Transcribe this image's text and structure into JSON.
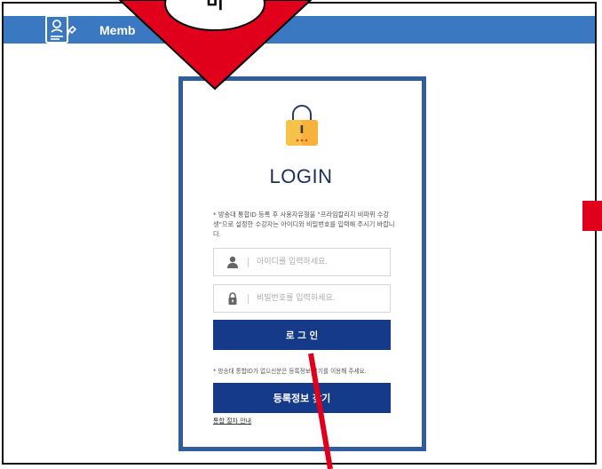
{
  "header": {
    "title": "Memb"
  },
  "annotation": {
    "step_label": "비"
  },
  "login": {
    "title": "LOGIN",
    "notice": "* 방송대 통합ID 등록 후 사용자유형을 \"프라임칼리지 비파위 수강생\"으로 설정한 수강자는 아이디와 비밀번호를 입력해 주시기 바랍니다.",
    "id_placeholder": "아이디를 입력하세요.",
    "pw_placeholder": "비밀번호를 입력하세요.",
    "login_button": "로 그 인",
    "notice2": "* 방송대 통합ID가 없으신분은 등록정보 찾기를 이용해 주세요.",
    "find_button": "등록정보 찾기",
    "guide_link": "통합 절차 안내"
  },
  "colors": {
    "header_blue": "#3b78c2",
    "button_navy": "#163a8a",
    "card_border": "#2f5d9e",
    "annotation_red": "#e0001b",
    "lock_yellow": "#f5c34a"
  },
  "icons": [
    "profile-document-icon",
    "lock-icon",
    "user-icon",
    "padlock-icon"
  ]
}
